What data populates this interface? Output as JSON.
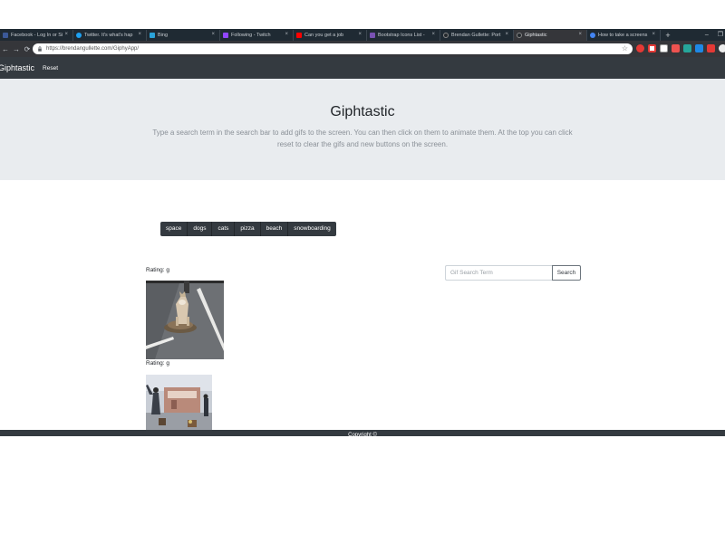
{
  "browser": {
    "tabs": [
      {
        "title": "Facebook - Log In or Si",
        "icon": "facebook-icon",
        "color": "#3b5998"
      },
      {
        "title": "Twitter. It's what's hap",
        "icon": "twitter-icon",
        "color": "#1da1f2"
      },
      {
        "title": "Bing",
        "icon": "bing-icon",
        "color": "#2aa3d9"
      },
      {
        "title": "Following - Twitch",
        "icon": "twitch-icon",
        "color": "#9146ff"
      },
      {
        "title": "Can you get a job",
        "icon": "youtube-icon",
        "color": "#ff0000"
      },
      {
        "title": "Bootstrap Icons List -",
        "icon": "bootstrap-icon",
        "color": "#7952b3"
      },
      {
        "title": "Brendan Gullette: Port",
        "icon": "github-icon",
        "color": "#24292e"
      },
      {
        "title": "Giphtastic",
        "icon": "github-icon",
        "color": "#24292e",
        "active": true
      },
      {
        "title": "How to take a screens",
        "icon": "google-icon",
        "color": "#4285f4"
      }
    ],
    "new_tab_symbol": "+",
    "tab_close_symbol": "×",
    "window_controls": {
      "minimize": "–",
      "restore": "❐"
    },
    "nav": {
      "back": "←",
      "forward": "→",
      "reload": "⟳"
    },
    "url": "https://brendangullette.com/GiphyApp/",
    "bookmark_symbol": "☆"
  },
  "navbar": {
    "brand": "Giphtastic",
    "reset_label": "Reset"
  },
  "jumbotron": {
    "title": "Giphtastic",
    "text": "Type a search term in the search bar to add gifs to the screen. You can then click on them to animate them. At the top you can click reset to clear the gifs and new buttons on the screen."
  },
  "topics": [
    "space",
    "dogs",
    "cats",
    "pizza",
    "beach",
    "snowboarding"
  ],
  "gifs": [
    {
      "rating_label": "Rating: g",
      "image": "dog-on-tortoise-gif"
    },
    {
      "rating_label": "Rating: g",
      "image": "street-scene-gif"
    }
  ],
  "search": {
    "placeholder": "Gif Search Term",
    "button_label": "Search"
  },
  "footer": {
    "text": "Copyright ©"
  },
  "colors": {
    "navbar_bg": "#343a40",
    "jumbotron_bg": "#e9ecef",
    "button_bg": "#343a40",
    "tabstrip_bg": "#1f2a33"
  }
}
